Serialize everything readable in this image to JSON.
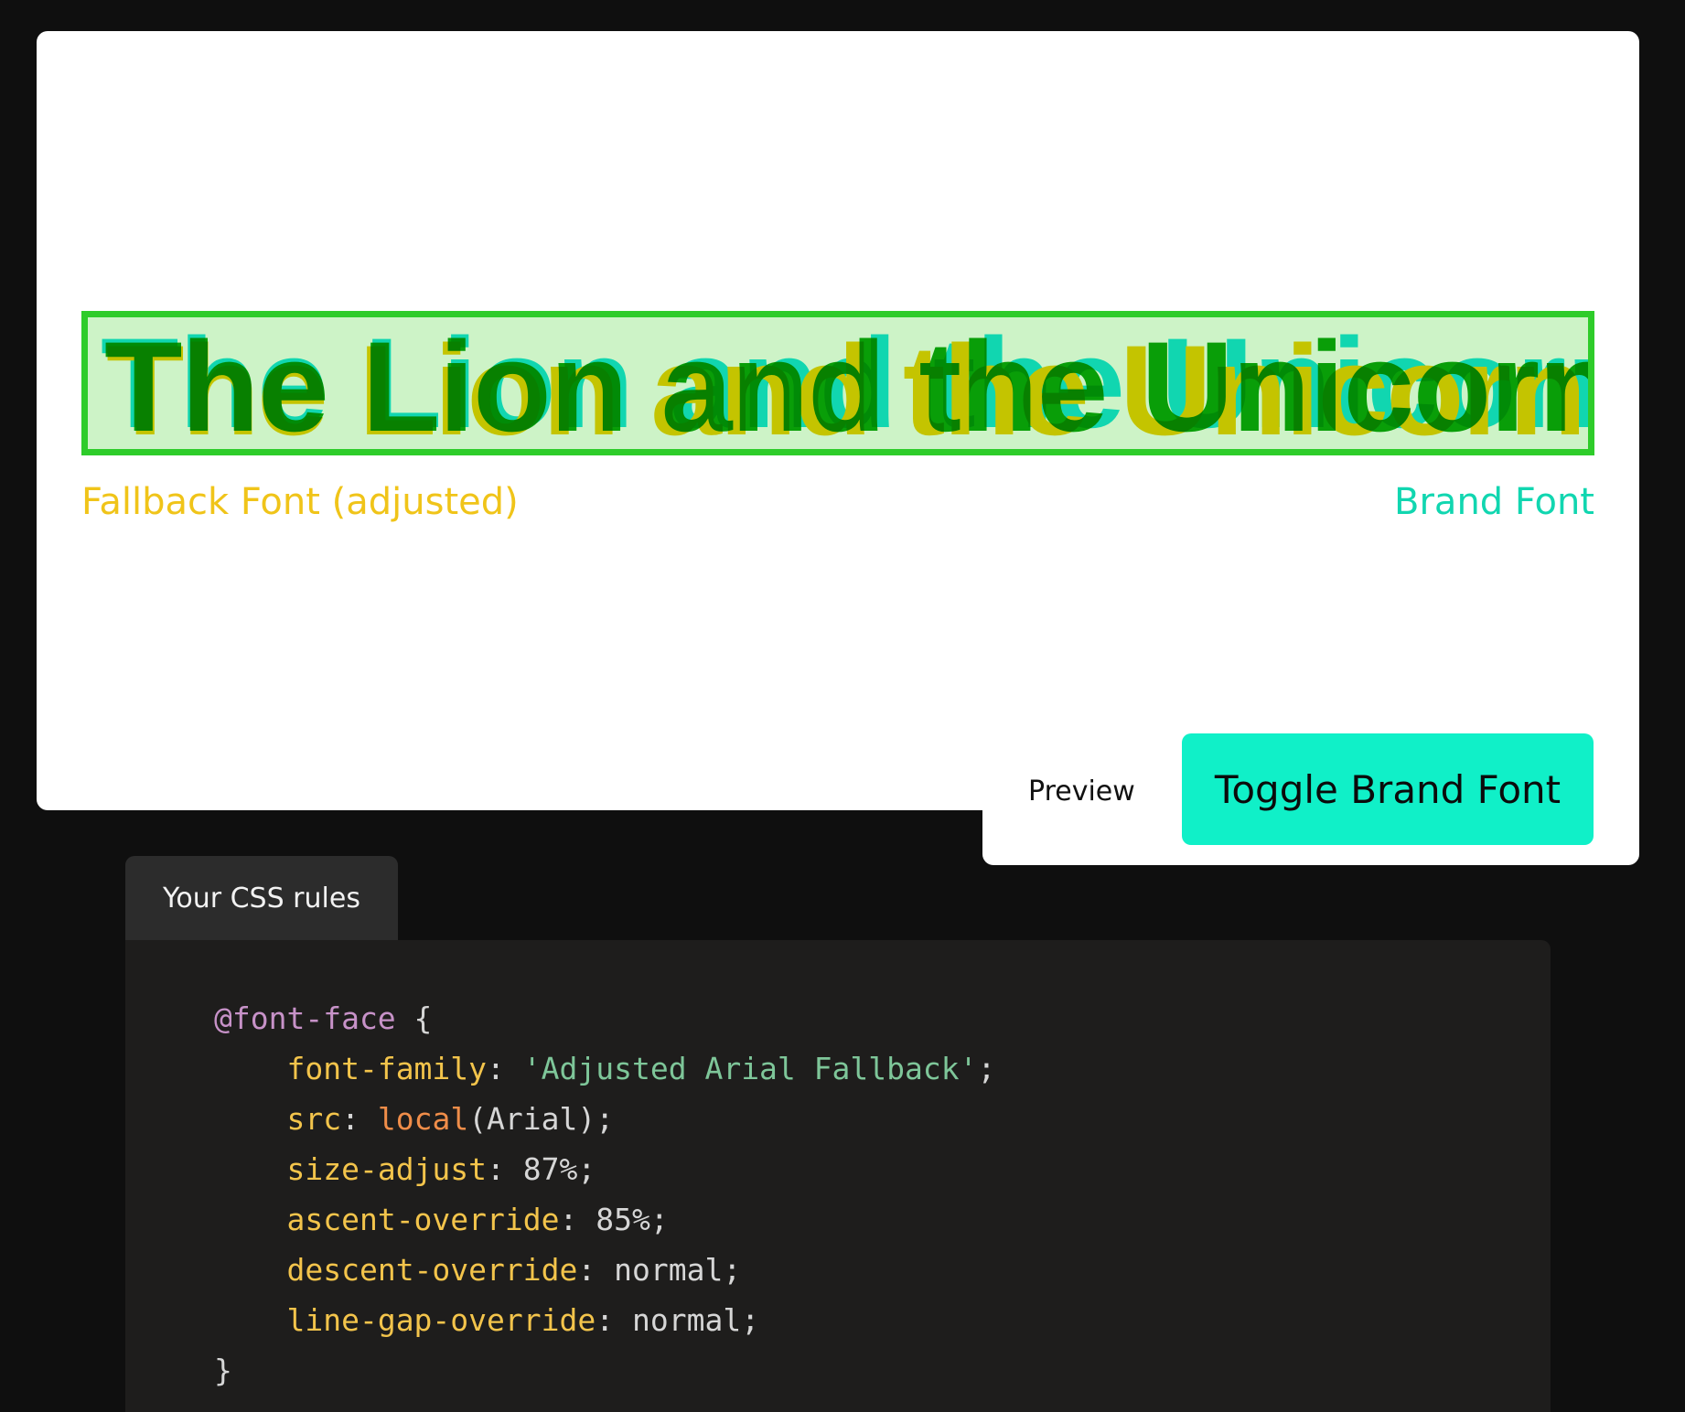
{
  "sample": {
    "text": "The Lion and the Unicorn"
  },
  "legend": {
    "fallback": "Fallback Font (adjusted)",
    "brand": "Brand Font"
  },
  "toggle": {
    "preview_label": "Preview",
    "button_label": "Toggle Brand Font"
  },
  "code_section": {
    "tab_label": "Your CSS rules",
    "at_rule": "@font-face",
    "open_brace": " {",
    "close_brace": "}",
    "rules": [
      {
        "prop": "font-family",
        "sep": ": ",
        "value": "'Adjusted Arial Fallback'",
        "end": ";"
      },
      {
        "prop": "src",
        "sep": ": ",
        "fn": "local",
        "value": "(Arial)",
        "end": ";"
      },
      {
        "prop": "size-adjust",
        "sep": ": ",
        "value": "87%",
        "end": ";"
      },
      {
        "prop": "ascent-override",
        "sep": ": ",
        "value": "85%",
        "end": ";"
      },
      {
        "prop": "descent-override",
        "sep": ": ",
        "value": "normal",
        "end": ";"
      },
      {
        "prop": "line-gap-override",
        "sep": ": ",
        "value": "normal",
        "end": ";"
      }
    ]
  },
  "colors": {
    "fallback": "#f0c419",
    "brand": "#11d6b0",
    "button": "#10f0c8",
    "sample_border": "#2ecc2a",
    "sample_bg": "#cdf3c7"
  }
}
